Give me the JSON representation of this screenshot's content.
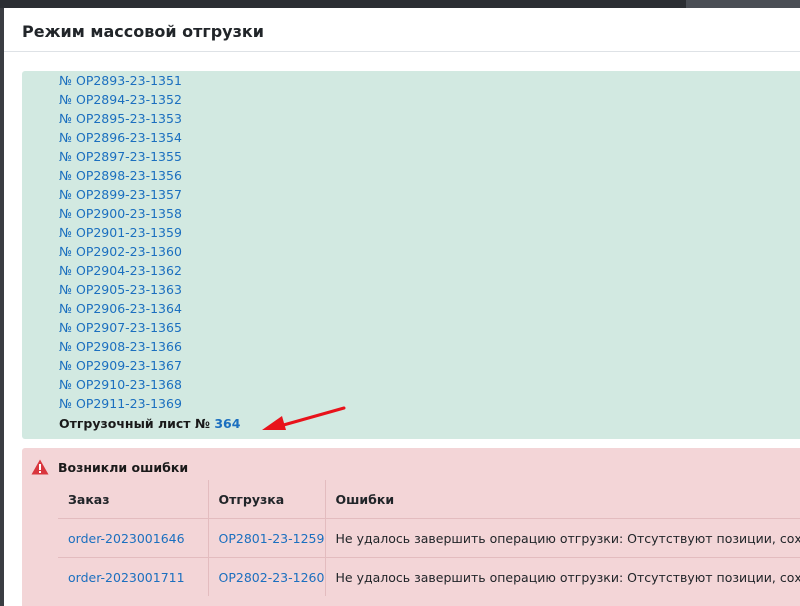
{
  "modal": {
    "title": "Режим массовой отгрузки"
  },
  "success": {
    "shipments": [
      "№ ОР2893-23-1351",
      "№ ОР2894-23-1352",
      "№ ОР2895-23-1353",
      "№ ОР2896-23-1354",
      "№ ОР2897-23-1355",
      "№ ОР2898-23-1356",
      "№ ОР2899-23-1357",
      "№ ОР2900-23-1358",
      "№ ОР2901-23-1359",
      "№ ОР2902-23-1360",
      "№ ОР2904-23-1362",
      "№ ОР2905-23-1363",
      "№ ОР2906-23-1364",
      "№ ОР2907-23-1365",
      "№ ОР2908-23-1366",
      "№ ОР2909-23-1367",
      "№ ОР2910-23-1368",
      "№ ОР2911-23-1369"
    ],
    "sheet_label": "Отгрузочный лист №",
    "sheet_number": "364"
  },
  "errors": {
    "title": "Возникли ошибки",
    "columns": [
      "Заказ",
      "Отгрузка",
      "Ошибки"
    ],
    "rows": [
      {
        "order": "order-2023001646",
        "shipment": "ОР2801-23-1259",
        "error": "Не удалось завершить операцию отгрузки: Отсутствуют позиции, сохранение невозможно"
      },
      {
        "order": "order-2023001711",
        "shipment": "ОР2802-23-1260",
        "error": "Не удалось завершить операцию отгрузки: Отсутствуют позиции, сохранение невозможно"
      }
    ]
  },
  "colors": {
    "success_bg": "#d2e9e1",
    "error_bg": "#f3d5d7",
    "link": "#1b6fbf",
    "annotation_arrow": "#e8131b",
    "error_icon": "#d9363e"
  },
  "icons": {
    "error": "warning-triangle-icon",
    "annotation": "red-arrow-icon"
  }
}
